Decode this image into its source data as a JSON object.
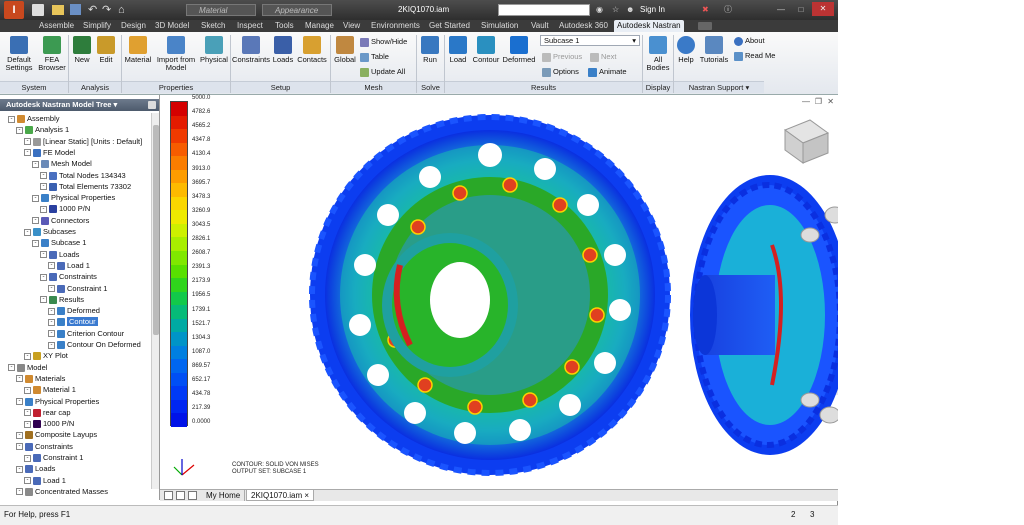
{
  "titlebar": {
    "search_placeholder": "",
    "material": "Material",
    "appearance": "Appearance",
    "filename": "2KIQ1070.iam",
    "signin": "Sign In"
  },
  "tabs": [
    "Assemble",
    "Simplify",
    "Design",
    "3D Model",
    "Sketch",
    "Inspect",
    "Tools",
    "Manage",
    "View",
    "Environments",
    "Get Started",
    "Simulation",
    "Vault",
    "Autodesk 360",
    "Autodesk Nastran"
  ],
  "ribbon": {
    "system": {
      "label": "System",
      "default_settings": "Default Settings",
      "fea_browser": "FEA Browser"
    },
    "analysis": {
      "label": "Analysis",
      "new": "New",
      "edit": "Edit"
    },
    "properties": {
      "label": "Properties",
      "material": "Material",
      "import_from_model": "Import from Model",
      "physical": "Physical"
    },
    "setup": {
      "label": "Setup",
      "constraints": "Constraints",
      "loads": "Loads",
      "contacts": "Contacts"
    },
    "mesh": {
      "label": "Mesh",
      "global": "Global",
      "show_hide": "Show/Hide",
      "table": "Table",
      "update_all": "Update  All"
    },
    "solve": {
      "label": "Solve",
      "run": "Run"
    },
    "results": {
      "label": "Results",
      "load": "Load",
      "contour": "Contour",
      "deformed": "Deformed",
      "subcase": "Subcase 1",
      "previous": "Previous",
      "next": "Next",
      "options": "Options",
      "animate": "Animate"
    },
    "display": {
      "label": "Display",
      "all_bodies": "All Bodies"
    },
    "support": {
      "label": "Nastran Support",
      "help": "Help",
      "tutorials": "Tutorials",
      "about": "About",
      "read_me": "Read Me"
    }
  },
  "tree": {
    "title": "Autodesk Nastran Model Tree",
    "rows": [
      "Assembly",
      "Analysis 1",
      "[Linear Static] [Units : Default]",
      "FE Model",
      "Mesh Model",
      "Total Nodes 134343",
      "Total Elements 73302",
      "Physical Properties",
      "1000 P/N",
      "Connectors",
      "Subcases",
      "Subcase 1",
      "Loads",
      "Load 1",
      "Constraints",
      "Constraint 1",
      "Results",
      "Deformed",
      "Contour",
      "Criterion Contour",
      "Contour On Deformed",
      "XY Plot",
      "Model",
      "Materials",
      "Material 1",
      "Physical Properties",
      "rear cap",
      "1000 P/N",
      "Composite Layups",
      "Constraints",
      "Constraint 1",
      "Loads",
      "Load 1",
      "Concentrated Masses"
    ]
  },
  "legend": {
    "values": [
      "5000.0",
      "4782.6",
      "4565.2",
      "4347.8",
      "4130.4",
      "3913.0",
      "3695.7",
      "3478.3",
      "3260.9",
      "3043.5",
      "2826.1",
      "2608.7",
      "2391.3",
      "2173.9",
      "1956.5",
      "1739.1",
      "1521.7",
      "1304.3",
      "1087.0",
      "869.57",
      "652.17",
      "434.78",
      "217.39",
      "0.0000"
    ],
    "colors": [
      "#d40000",
      "#e41b00",
      "#f03a00",
      "#f75c00",
      "#fb7d00",
      "#fd9c00",
      "#fdba00",
      "#fbd600",
      "#eeea00",
      "#cdf000",
      "#a8ee00",
      "#80e800",
      "#58e000",
      "#2fd51c",
      "#12c94a",
      "#06bb78",
      "#00aaa3",
      "#0094c7",
      "#007fe0",
      "#0066f0",
      "#004ff5",
      "#003af6",
      "#0026f2",
      "#0012e8"
    ]
  },
  "viewport": {
    "contour_label": "CONTOUR: SOLID VON MISES",
    "output_label": "OUTPUT SET: SUBCASE 1"
  },
  "doctabs": {
    "my_home": "My Home",
    "file": "2KIQ1070.iam"
  },
  "status": {
    "help": "For Help, press F1",
    "n1": "2",
    "n2": "3"
  }
}
